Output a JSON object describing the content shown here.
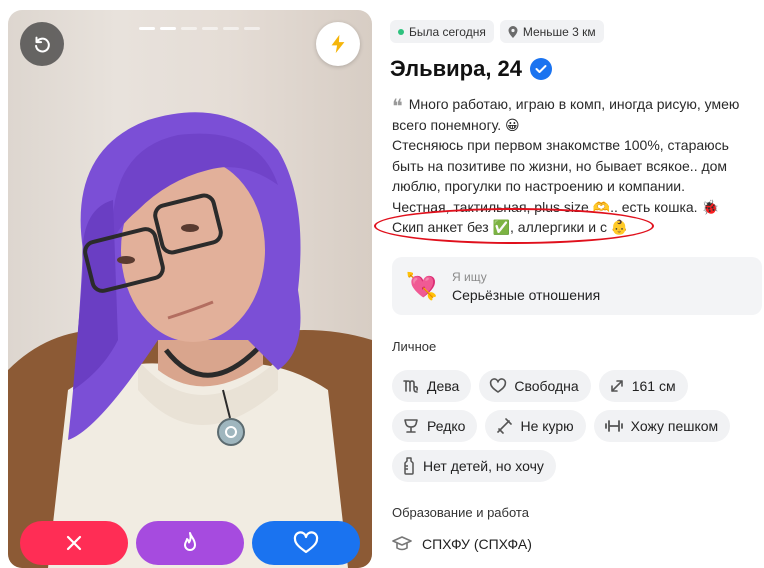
{
  "photo": {
    "progress_total": 6,
    "progress_active": 1,
    "undo_icon": "undo-icon",
    "boost_icon": "lightning-icon",
    "actions": [
      {
        "name": "dislike",
        "icon": "close-icon",
        "color": "#ff2d55"
      },
      {
        "name": "superlike",
        "icon": "flame-icon",
        "color": "#a64bdf"
      },
      {
        "name": "like",
        "icon": "heart-icon",
        "color": "#1a73f0"
      }
    ],
    "accent_boost": "#f5b50a"
  },
  "profile": {
    "badges": {
      "online": "Была сегодня",
      "distance": "Меньше 3 км"
    },
    "name": "Эльвира, 24",
    "verified_color": "#1a73f0",
    "bio": {
      "line1": "Много работаю, играю в комп, иногда рисую, умею всего понемногу. 😀",
      "line2": "Стесняюсь при первом знакомстве 100%, стараюсь быть на позитиве по жизни, но бывает всякое.. дом люблю, прогулки по настроению и компании.",
      "line3": "Честная, тактильная, plus size 🫶.. есть кошка. 🐞",
      "line4": "Скип анкет без ✅, аллергики и с 👶"
    },
    "seeking": {
      "label": "Я ищу",
      "value": "Серьёзные отношения",
      "emoji": "💘"
    },
    "personal_title": "Личное",
    "personal_chips": [
      {
        "icon": "virgo-icon",
        "label": "Дева"
      },
      {
        "icon": "heart-outline-icon",
        "label": "Свободна"
      },
      {
        "icon": "height-icon",
        "label": "161 см"
      },
      {
        "icon": "glass-icon",
        "label": "Редко"
      },
      {
        "icon": "no-smoking-icon",
        "label": "Не курю"
      },
      {
        "icon": "dumbbell-icon",
        "label": "Хожу пешком"
      },
      {
        "icon": "baby-bottle-icon",
        "label": "Нет детей, но хочу"
      }
    ],
    "education_title": "Образование и работа",
    "education_value": "СПХФУ (СПХФА)",
    "highlight_color": "#e0101c"
  }
}
